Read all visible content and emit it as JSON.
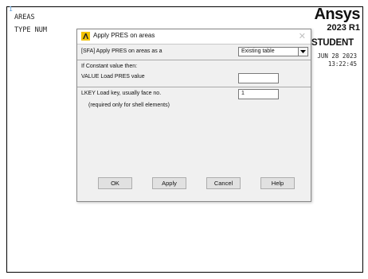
{
  "viewport": {
    "index": "1",
    "lines": [
      "AREAS",
      "TYPE NUM"
    ]
  },
  "brand": {
    "name": "Ansys",
    "version": "2023 R1",
    "edition": "STUDENT",
    "date": "JUN 28 2023",
    "time": "13:22:45"
  },
  "dialog": {
    "title": "Apply PRES on areas",
    "apply_as_label": "[SFA] Apply PRES on areas as a",
    "apply_as_value": "Existing table",
    "constant_header": "If Constant value then:",
    "value_label": "VALUE  Load PRES value",
    "value_input": "",
    "lkey_label": "LKEY  Load key, usually face no.",
    "lkey_input": "1",
    "lkey_note": "(required only for shell elements)",
    "buttons": {
      "ok": "OK",
      "apply": "Apply",
      "cancel": "Cancel",
      "help": "Help"
    }
  }
}
